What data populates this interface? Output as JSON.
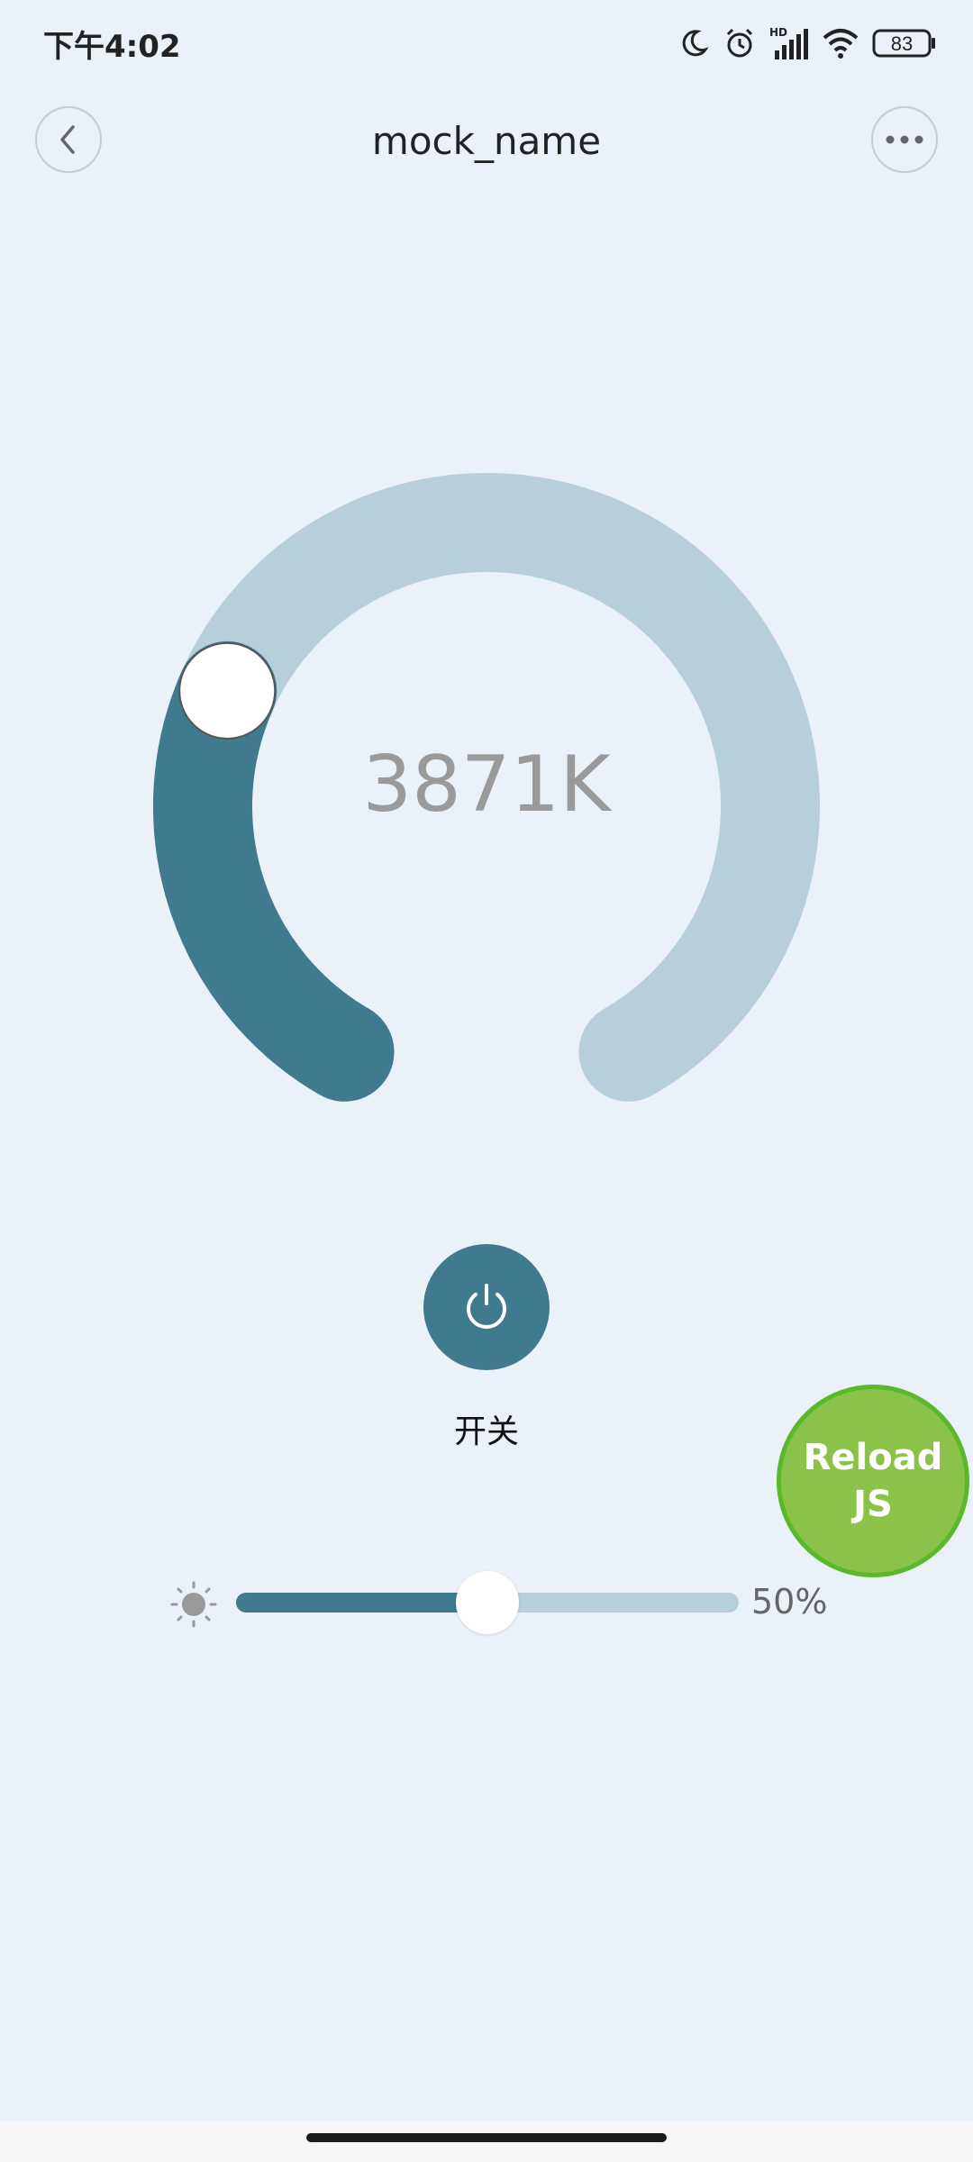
{
  "status_bar": {
    "time": "下午4:02",
    "battery": "83",
    "icons": [
      "moon-icon",
      "alarm-icon",
      "hd-signal-icon",
      "wifi-icon",
      "battery-icon"
    ]
  },
  "nav": {
    "title": "mock_name",
    "back_icon": "chevron-left-icon",
    "more_icon": "more-dots-icon"
  },
  "dial": {
    "value_label": "3871K",
    "level": 0.28,
    "colors": {
      "track": "#b6cfd9",
      "fill": "#3f7a8e"
    }
  },
  "power": {
    "icon": "power-icon",
    "label": "开关",
    "color": "#3f7a8e"
  },
  "reload": {
    "line1": "Reload",
    "line2": "JS",
    "color": "#8bc34a"
  },
  "brightness": {
    "icon": "sun-icon",
    "value": 0.5,
    "label": "50%"
  }
}
